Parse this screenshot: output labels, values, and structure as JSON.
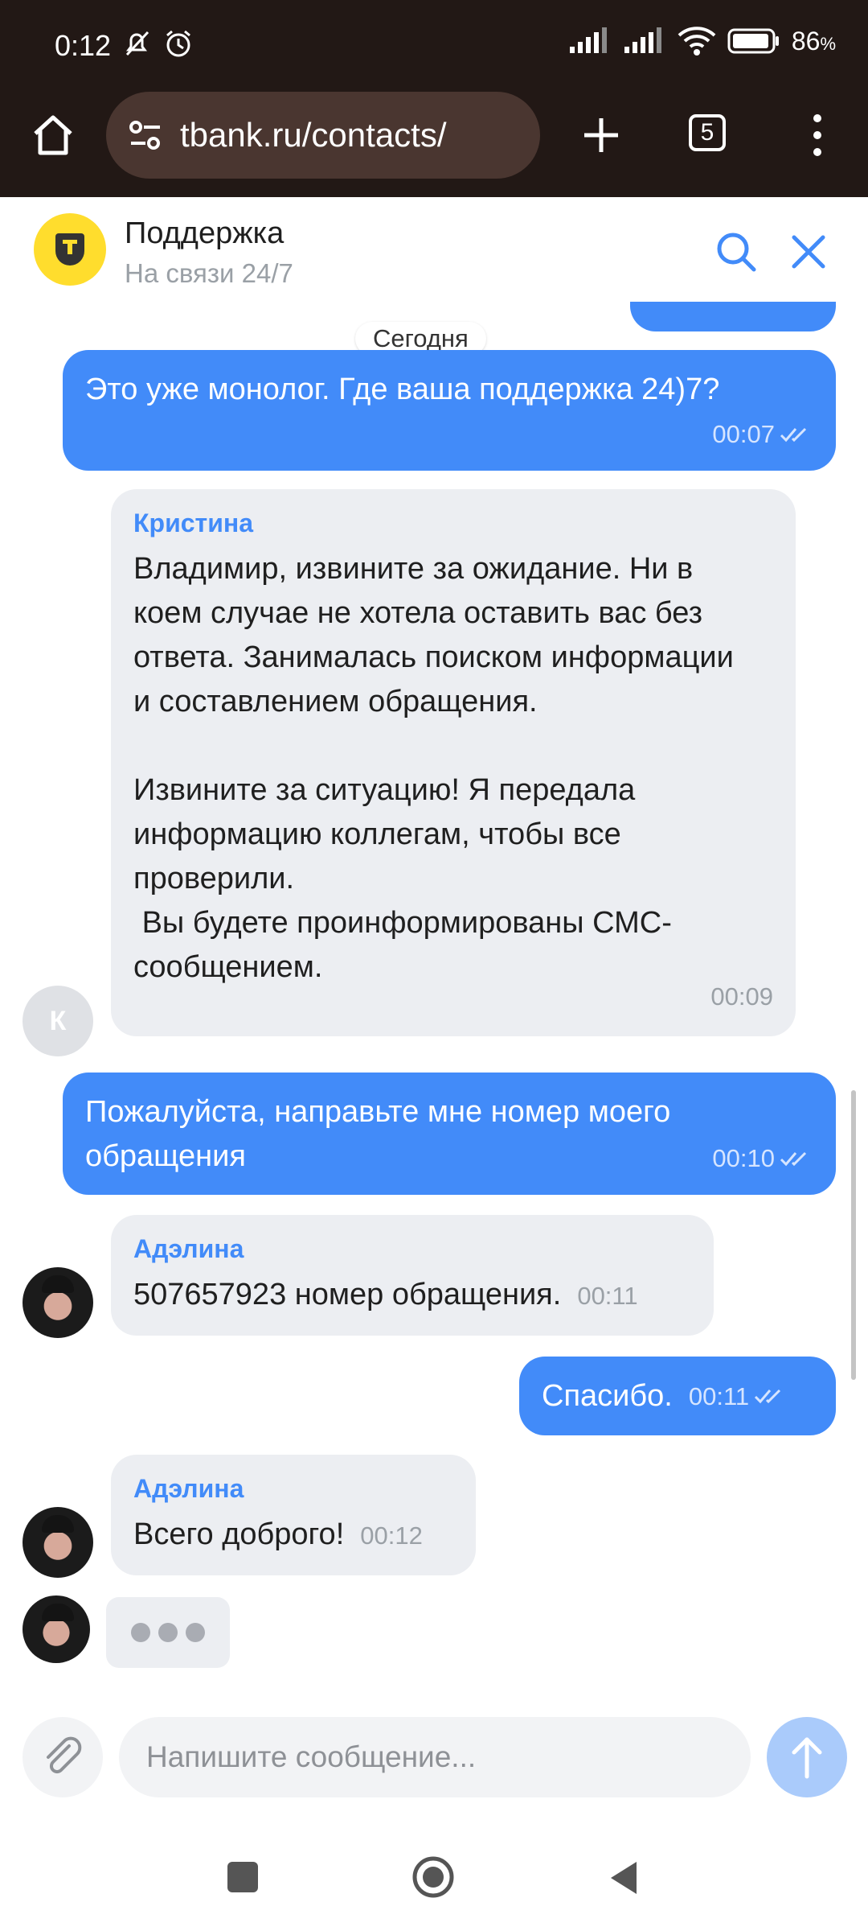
{
  "status_bar": {
    "time": "0:12",
    "battery_percent": "86",
    "battery_unit": "%",
    "icons": [
      "mute-bell-icon",
      "alarm-icon",
      "signal-icon",
      "signal-icon",
      "wifi-icon",
      "battery-icon"
    ]
  },
  "browser": {
    "url": "tbank.ru/contacts/",
    "tabs_count": "5"
  },
  "chat_header": {
    "title": "Поддержка",
    "subtitle": "На связи 24/7"
  },
  "date_separator": "Сегодня",
  "messages": [
    {
      "direction": "out",
      "text": "Это уже монолог. Где ваша поддержка 24)7?",
      "time": "00:07"
    },
    {
      "direction": "in",
      "sender": "Кристина",
      "avatar_letter": "К",
      "text": "Владимир, извините за ожидание. Ни в коем случае не хотела оставить вас без ответа. Занималась поиском информации и составлением обращения.\n\nИзвините за ситуацию! Я передала информацию коллегам, чтобы все проверили.\n Вы будете проинформированы СМС-сообщением.",
      "time": "00:09"
    },
    {
      "direction": "out",
      "text": "Пожалуйста, направьте мне номер моего обращения",
      "time": "00:10"
    },
    {
      "direction": "in",
      "sender": "Адэлина",
      "text": "507657923 номер обращения.",
      "time": "00:11"
    },
    {
      "direction": "out",
      "text": "Спасибо.",
      "time": "00:11"
    },
    {
      "direction": "in",
      "sender": "Адэлина",
      "text": "Всего доброго!",
      "time": "00:12"
    }
  ],
  "composer": {
    "placeholder": "Напишите сообщение..."
  },
  "colors": {
    "outgoing_bubble": "#428bf9",
    "incoming_bubble": "#eceef2",
    "sender_name": "#428bf9",
    "brand_yellow": "#ffdd2d",
    "browser_chrome": "#221815"
  }
}
